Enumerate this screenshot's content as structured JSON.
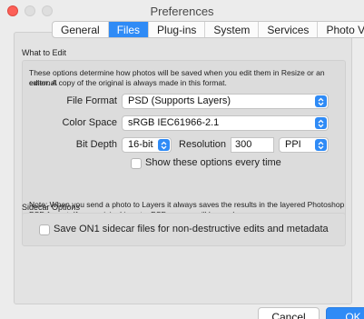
{
  "window": {
    "title": "Preferences"
  },
  "tabs": [
    {
      "label": "General"
    },
    {
      "label": "Files"
    },
    {
      "label": "Plug-ins"
    },
    {
      "label": "System"
    },
    {
      "label": "Services"
    },
    {
      "label": "Photo Via"
    }
  ],
  "what_to_edit": {
    "heading": "What to Edit",
    "description_line1": "These options determine how photos will be saved when you edit them in Resize or an external",
    "description_line2": "editor.  A copy of the original is always made in this format.",
    "file_format_label": "File Format",
    "file_format_value": "PSD (Supports Layers)",
    "color_space_label": "Color Space",
    "color_space_value": "sRGB IEC61966-2.1",
    "bit_depth_label": "Bit Depth",
    "bit_depth_value": "16-bit",
    "resolution_label": "Resolution",
    "resolution_value": "300",
    "resolution_unit": "PPI",
    "show_options_label": "Show these options every time",
    "note_line1": "Note: When you send a photo to Layers it always saves the results in the layered Photoshop",
    "note_line2": "PSD format.  If your original is not a PSD, a copy will be made."
  },
  "sidecar": {
    "heading": "Sidecar Options",
    "save_label": "Save ON1 sidecar files for non-destructive edits and metadata"
  },
  "buttons": {
    "cancel": "Cancel",
    "ok": "OK"
  }
}
